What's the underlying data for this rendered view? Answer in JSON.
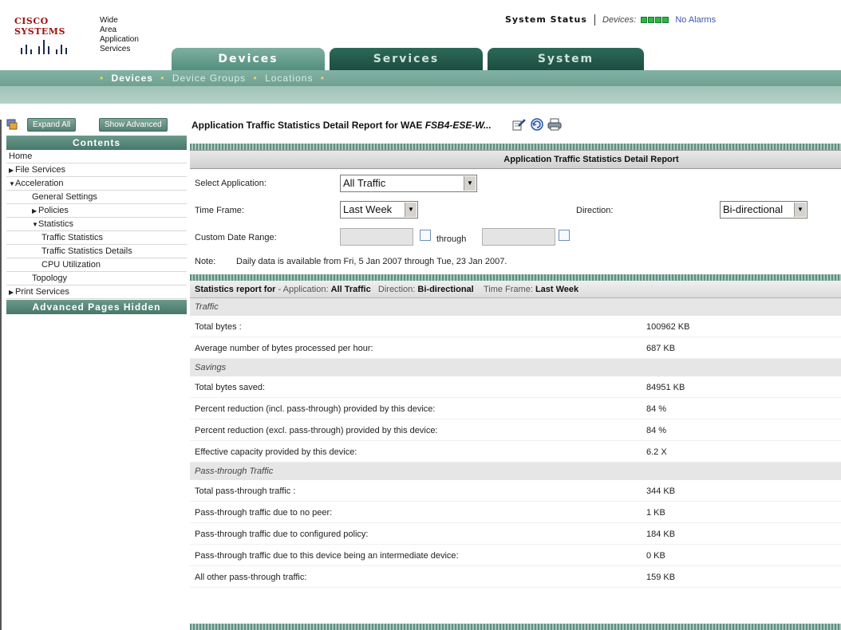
{
  "header": {
    "brand": "CISCO SYSTEMS",
    "product_lines": [
      "Wide",
      "Area",
      "Application",
      "Services"
    ],
    "system_status_label": "System Status",
    "devices_label": "Devices:",
    "alarm_text": "No Alarms",
    "status_color": "#2fb34a"
  },
  "tabs": [
    {
      "label": "Devices",
      "active": true
    },
    {
      "label": "Services",
      "active": false
    },
    {
      "label": "System",
      "active": false
    }
  ],
  "subnav": {
    "items": [
      "Devices",
      "Device Groups",
      "Locations"
    ]
  },
  "toolbar": {
    "expand_all": "Expand All",
    "show_advanced": "Show Advanced",
    "report_title_prefix": "Application Traffic Statistics Detail Report for WAE ",
    "report_title_device": "FSB4-ESE-W...",
    "icons": [
      "edit-report-icon",
      "refresh-icon",
      "print-icon"
    ]
  },
  "sidebar": {
    "contents_label": "Contents",
    "items": [
      {
        "label": "Home",
        "level": 0,
        "tri": ""
      },
      {
        "label": "File Services",
        "level": 0,
        "tri": "▶"
      },
      {
        "label": "Acceleration",
        "level": 0,
        "tri": "▼"
      },
      {
        "label": "General Settings",
        "level": 1,
        "tri": ""
      },
      {
        "label": "Policies",
        "level": 1,
        "tri": "▶"
      },
      {
        "label": "Statistics",
        "level": 1,
        "tri": "▼"
      },
      {
        "label": "Traffic Statistics",
        "level": 2,
        "tri": ""
      },
      {
        "label": "Traffic Statistics Details",
        "level": 2,
        "tri": ""
      },
      {
        "label": "CPU Utilization",
        "level": 2,
        "tri": ""
      },
      {
        "label": "Topology",
        "level": 1,
        "tri": ""
      },
      {
        "label": "Print Services",
        "level": 0,
        "tri": "▶"
      }
    ],
    "advanced_hidden_label": "Advanced Pages Hidden"
  },
  "form": {
    "heading": "Application Traffic Statistics Detail Report",
    "select_application_label": "Select Application:",
    "select_application_value": "All Traffic",
    "time_frame_label": "Time Frame:",
    "time_frame_value": "Last Week",
    "direction_label": "Direction:",
    "direction_value": "Bi-directional",
    "custom_range_label": "Custom Date Range:",
    "through_label": "through",
    "note_label": "Note:",
    "note_text": "Daily data is available from Fri, 5 Jan 2007 through Tue, 23 Jan 2007."
  },
  "stats": {
    "heading_bold": "Statistics report for",
    "app_label": "Application:",
    "app_value": "All Traffic",
    "dir_label": "Direction:",
    "dir_value": "Bi-directional",
    "tf_label": "Time Frame:",
    "tf_value": "Last Week",
    "sections": [
      {
        "title": "Traffic",
        "rows": [
          {
            "label": "Total bytes :",
            "value": "100962 KB"
          },
          {
            "label": "Average number of bytes processed per hour:",
            "value": "687 KB"
          }
        ]
      },
      {
        "title": "Savings",
        "rows": [
          {
            "label": "Total bytes saved:",
            "value": "84951 KB"
          },
          {
            "label": "Percent reduction (incl. pass-through) provided by this device:",
            "value": "84 %"
          },
          {
            "label": "Percent reduction (excl. pass-through) provided by this device:",
            "value": "84 %"
          },
          {
            "label": "Effective capacity provided by this device:",
            "value": "6.2 X"
          }
        ]
      },
      {
        "title": "Pass-through Traffic",
        "rows": [
          {
            "label": "Total pass-through traffic :",
            "value": "344 KB"
          },
          {
            "label": "Pass-through traffic due to no peer:",
            "value": "1 KB"
          },
          {
            "label": "Pass-through traffic due to configured policy:",
            "value": "184 KB"
          },
          {
            "label": "Pass-through traffic due to this device being an intermediate device:",
            "value": "0 KB"
          },
          {
            "label": "All other pass-through traffic:",
            "value": "159 KB"
          }
        ]
      }
    ]
  }
}
